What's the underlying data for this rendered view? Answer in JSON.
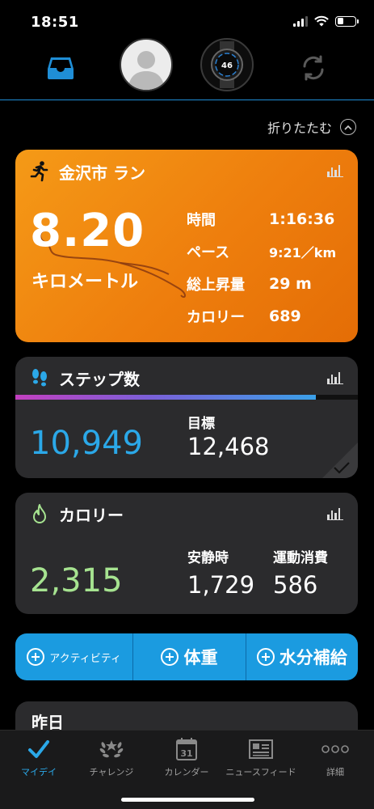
{
  "status_bar": {
    "time": "18:51"
  },
  "header": {
    "collapse_label": "折りたたむ"
  },
  "run_card": {
    "title": "金沢市 ラン",
    "distance": "8.20",
    "unit": "キロメートル",
    "stats": [
      {
        "label": "時間",
        "value": "1:16:36"
      },
      {
        "label": "ペース",
        "value": "9:21／km"
      },
      {
        "label": "総上昇量",
        "value": "29 m"
      },
      {
        "label": "カロリー",
        "value": "689"
      }
    ]
  },
  "steps_card": {
    "title": "ステップ数",
    "steps": "10,949",
    "goal_label": "目標",
    "goal": "12,468",
    "progress_fraction": 0.878,
    "colors": {
      "value": "#2ba8e8"
    }
  },
  "calories_card": {
    "title": "カロリー",
    "total": "2,315",
    "resting_label": "安静時",
    "resting": "1,729",
    "active_label": "運動消費",
    "active": "586",
    "colors": {
      "value": "#a6e390"
    }
  },
  "actions": {
    "activity": "アクティビティ",
    "weight": "体重",
    "hydration": "水分補給"
  },
  "yesterday": {
    "title": "昨日"
  },
  "watch": {
    "face_number": "46"
  },
  "tabs": [
    {
      "label": "マイデイ",
      "icon": "check-icon",
      "active": true
    },
    {
      "label": "チャレンジ",
      "icon": "laurel-icon",
      "active": false
    },
    {
      "label": "カレンダー",
      "icon": "calendar-icon",
      "active": false,
      "icon_text": "31"
    },
    {
      "label": "ニュースフィード",
      "icon": "newspaper-icon",
      "active": false
    },
    {
      "label": "詳細",
      "icon": "more-icon",
      "active": false
    }
  ],
  "colors": {
    "accent": "#1b9be0",
    "run_card": "#f08a12",
    "card_bg": "#2b2b2d"
  }
}
